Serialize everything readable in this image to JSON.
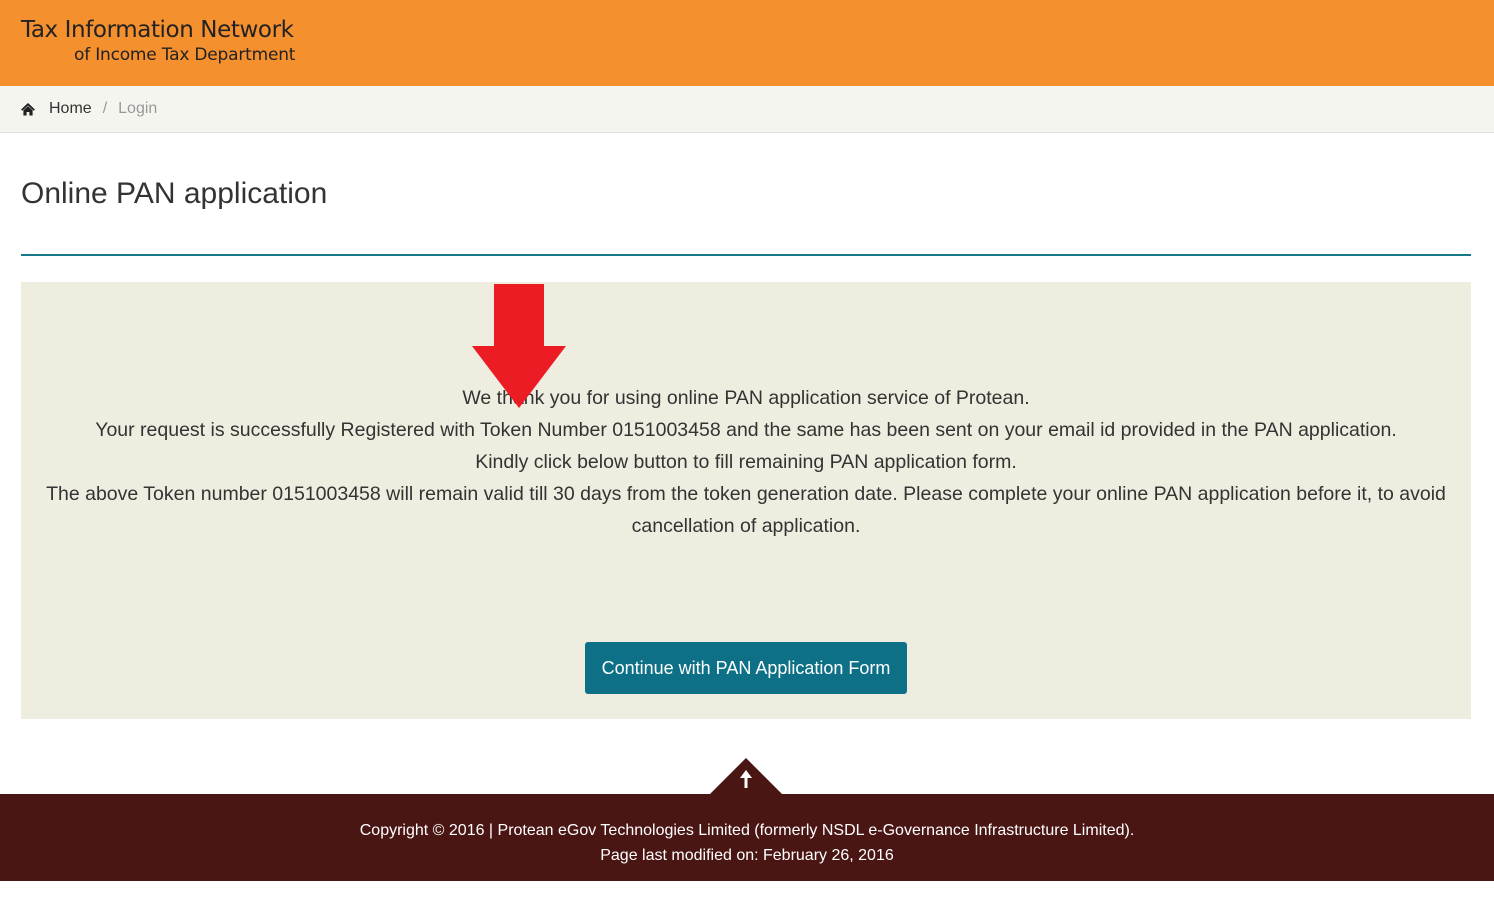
{
  "header": {
    "logo_line1": "Tax Information Network",
    "logo_line2": "of Income Tax Department",
    "background_color": "#f5902f"
  },
  "breadcrumb": {
    "icon": "home-icon",
    "home_label": "Home",
    "separator": "/",
    "current_label": "Login"
  },
  "main": {
    "title": "Online PAN application",
    "message_lines": [
      "We thank you for using online PAN application service of Protean.",
      "Your request is successfully Registered with Token Number 0151003458 and the same has been sent on your email id provided in the PAN application.",
      "Kindly click below button to fill remaining PAN application form.",
      "The above Token number 0151003458 will remain valid till 30 days from the token generation date. Please complete your online PAN application before it, to avoid cancellation of application."
    ],
    "continue_button_label": "Continue with PAN Application Form",
    "button_color": "#0d7086",
    "annotation_icon": "red-down-arrow-icon",
    "annotation_color": "#ec1c24"
  },
  "footer": {
    "scroll_top_icon": "arrow-up-icon",
    "copyright": "Copyright © 2016 | Protean eGov Technologies Limited (formerly NSDL e-Governance Infrastructure Limited).",
    "last_modified": "Page last modified on: February 26, 2016",
    "background_color": "#4a1614"
  }
}
